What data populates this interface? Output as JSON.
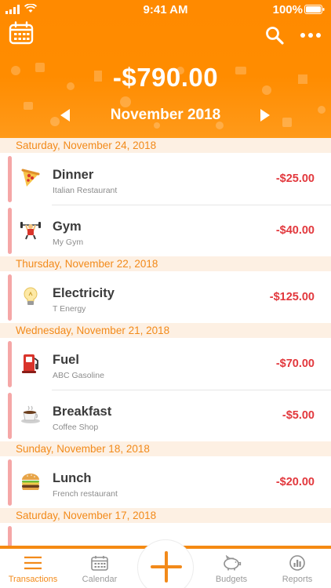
{
  "status_bar": {
    "time": "9:41 AM",
    "battery": "100%"
  },
  "header": {
    "balance": "-$790.00",
    "month": "November 2018"
  },
  "sections": [
    {
      "date": "Saturday, November 24, 2018",
      "items": [
        {
          "title": "Dinner",
          "subtitle": "Italian Restaurant",
          "amount": "-$25.00",
          "icon": "pizza-icon"
        },
        {
          "title": "Gym",
          "subtitle": "My Gym",
          "amount": "-$40.00",
          "icon": "weightlifter-icon"
        }
      ]
    },
    {
      "date": "Thursday, November 22, 2018",
      "items": [
        {
          "title": "Electricity",
          "subtitle": "T Energy",
          "amount": "-$125.00",
          "icon": "lightbulb-icon"
        }
      ]
    },
    {
      "date": "Wednesday, November 21, 2018",
      "items": [
        {
          "title": "Fuel",
          "subtitle": "ABC Gasoline",
          "amount": "-$70.00",
          "icon": "fuel-pump-icon"
        },
        {
          "title": "Breakfast",
          "subtitle": "Coffee Shop",
          "amount": "-$5.00",
          "icon": "coffee-icon"
        }
      ]
    },
    {
      "date": "Sunday, November 18, 2018",
      "items": [
        {
          "title": "Lunch",
          "subtitle": "French restaurant",
          "amount": "-$20.00",
          "icon": "burger-icon"
        }
      ]
    },
    {
      "date": "Saturday, November 17, 2018",
      "items": []
    }
  ],
  "tabs": {
    "transactions": "Transactions",
    "calendar": "Calendar",
    "budgets": "Budgets",
    "reports": "Reports"
  },
  "colors": {
    "brand_orange": "#ff8c00",
    "expense_red": "#e2383d",
    "section_bg": "#fdf0e3",
    "indicator_pink": "#f5a7a7"
  }
}
